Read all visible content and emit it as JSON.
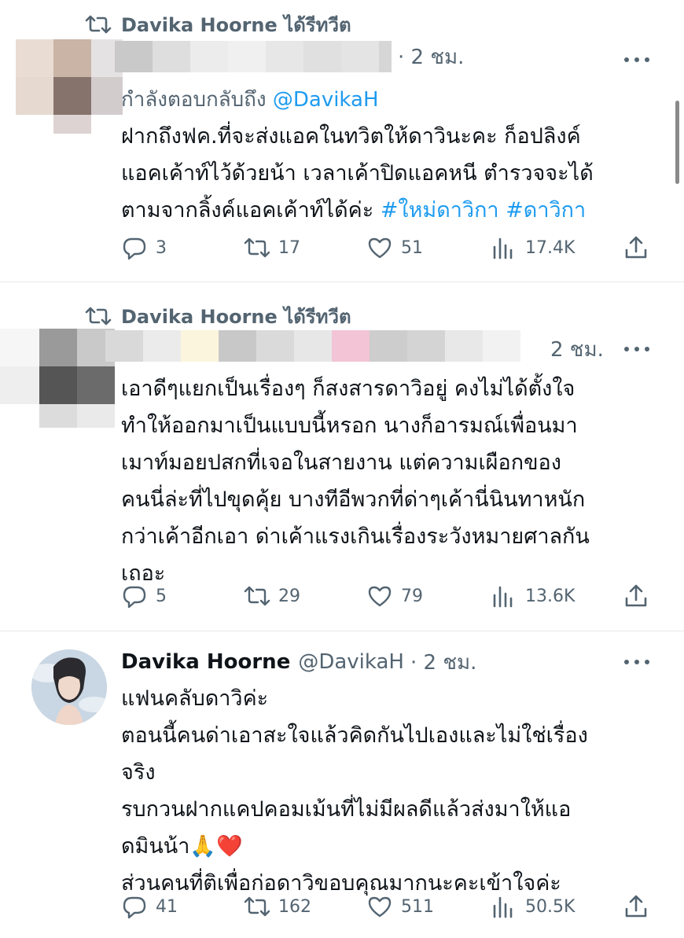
{
  "colors": {
    "link": "#1d9bf0",
    "muted": "#536471",
    "text": "#0f1419"
  },
  "tweets": [
    {
      "retweet_label": "Davika Hoorne ได้รีทวีต",
      "time": "· 2 ชม.",
      "replying_prefix": "กำลังตอบกลับถึง",
      "replying_handle": "@DavikaH",
      "text_main": "ฝากถึงฟค.ที่จะส่งแอคในทวิตให้ดาวินะคะ ก็อปลิงค์\nแอคเค้าท์ไว้ด้วยน้า เวลาเค้าปิดแอคหนี ตำรวจจะได้\nตามจากลิ้งค์แอคเค้าท์ได้ค่ะ ",
      "hashtag1": "#ใหม่ดาวิกา",
      "hashtag2": "#ดาวิกา",
      "replies": "3",
      "retweets": "17",
      "likes": "51",
      "views": "17.4K"
    },
    {
      "retweet_label": "Davika Hoorne ได้รีทวีต",
      "time": "2 ชม.",
      "text": "เอาดีๆแยกเป็นเรื่องๆ ก็สงสารดาวิอยู่ คงไม่ได้ตั้งใจ\nทำให้ออกมาเป็นแบบนี้หรอก นางก็อารมณ์เพื่อนมา\nเมาท์มอยปสกที่เจอในสายงาน แต่ความเผือกของ\nคนนี่ล่ะที่ไปขุดคุ้ย บางทีอีพวกที่ด่าๆเค้านี่นินทาหนัก\nกว่าเค้าอีกเอา ด่าเค้าแรงเกินเรื่องระวังหมายศาลกัน\nเถอะ",
      "replies": "5",
      "retweets": "29",
      "likes": "79",
      "views": "13.6K"
    },
    {
      "name": "Davika Hoorne",
      "handle": "@DavikaH",
      "time": "· 2 ชม.",
      "line1": "แฟนคลับดาวิค่ะ",
      "line2": "ตอนนี้คนด่าเอาสะใจแล้วคิดกันไปเองและไม่ใช่เรื่อง\nจริง",
      "line3": "รบกวนฝากแคปคอมเม้นที่ไม่มีผลดีแล้วส่งมาให้แอ\nดมินน้า",
      "emoji": "🙏❤️",
      "line4": "ส่วนคนที่ติเพื่อก่อดาวิขอบคุณมากนะคะเข้าใจค่ะ",
      "replies": "41",
      "retweets": "162",
      "likes": "511",
      "views": "50.5K"
    }
  ]
}
